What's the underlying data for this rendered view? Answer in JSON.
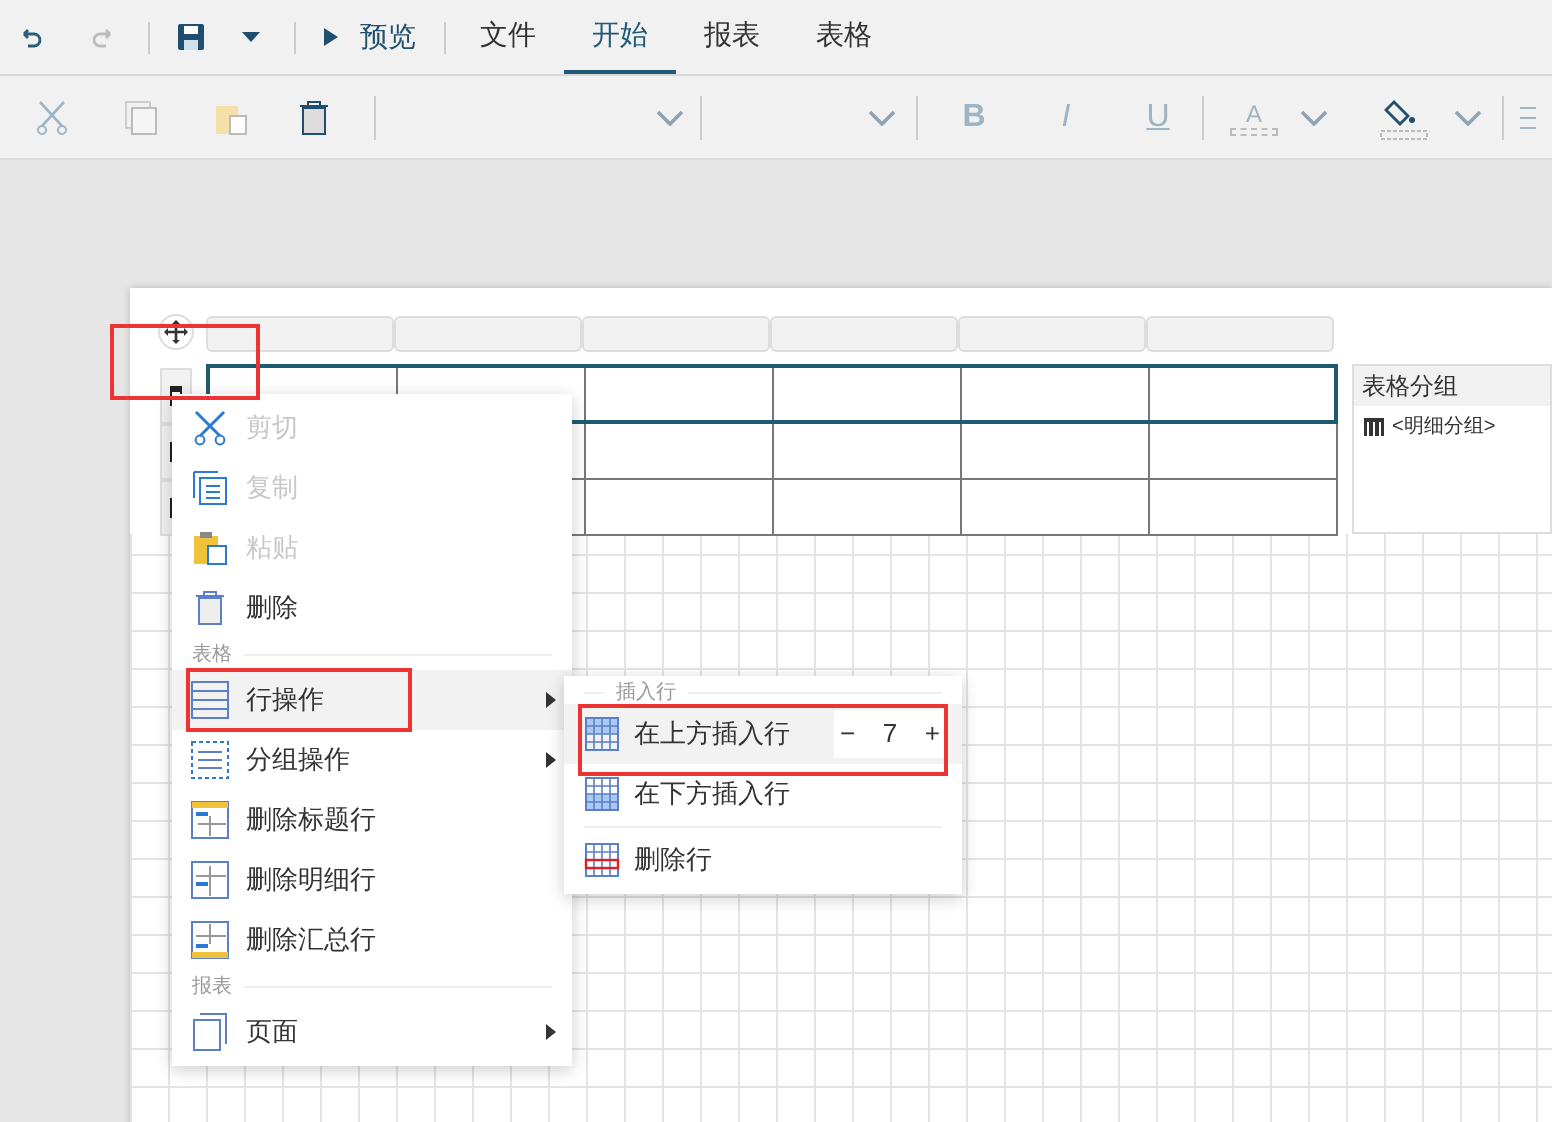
{
  "quick_toolbar": {
    "preview": "预览"
  },
  "menu_tabs": [
    {
      "label": "文件",
      "selected": false
    },
    {
      "label": "开始",
      "selected": true
    },
    {
      "label": "报表",
      "selected": false
    },
    {
      "label": "表格",
      "selected": false
    }
  ],
  "ribbon": {
    "bold": "B",
    "italic": "I",
    "underline": "U",
    "font_color": "A"
  },
  "group_panel": {
    "title": "表格分组",
    "items": [
      "<明细分组>"
    ]
  },
  "context_menu": [
    {
      "kind": "item",
      "label": "剪切",
      "disabled": true,
      "selected": false,
      "submenu": false
    },
    {
      "kind": "item",
      "label": "复制",
      "disabled": true,
      "selected": false,
      "submenu": false
    },
    {
      "kind": "item",
      "label": "粘贴",
      "disabled": true,
      "selected": false,
      "submenu": false
    },
    {
      "kind": "item",
      "label": "删除",
      "disabled": false,
      "selected": false,
      "submenu": false
    },
    {
      "kind": "section",
      "label": "表格"
    },
    {
      "kind": "item",
      "label": "行操作",
      "disabled": false,
      "selected": true,
      "submenu": true
    },
    {
      "kind": "item",
      "label": "分组操作",
      "disabled": false,
      "selected": false,
      "submenu": true
    },
    {
      "kind": "item",
      "label": "删除标题行",
      "disabled": false,
      "selected": false,
      "submenu": false
    },
    {
      "kind": "item",
      "label": "删除明细行",
      "disabled": false,
      "selected": false,
      "submenu": false
    },
    {
      "kind": "item",
      "label": "删除汇总行",
      "disabled": false,
      "selected": false,
      "submenu": false
    },
    {
      "kind": "section",
      "label": "报表"
    },
    {
      "kind": "item",
      "label": "页面",
      "disabled": false,
      "selected": false,
      "submenu": true
    }
  ],
  "submenu": [
    {
      "kind": "section",
      "label": "插入行"
    },
    {
      "kind": "stepper",
      "label": "在上方插入行",
      "selected": true,
      "minus": "−",
      "value": "7",
      "plus": "+"
    },
    {
      "kind": "item",
      "label": "在下方插入行",
      "selected": false
    },
    {
      "kind": "divider"
    },
    {
      "kind": "item",
      "label": "删除行",
      "selected": false
    }
  ]
}
